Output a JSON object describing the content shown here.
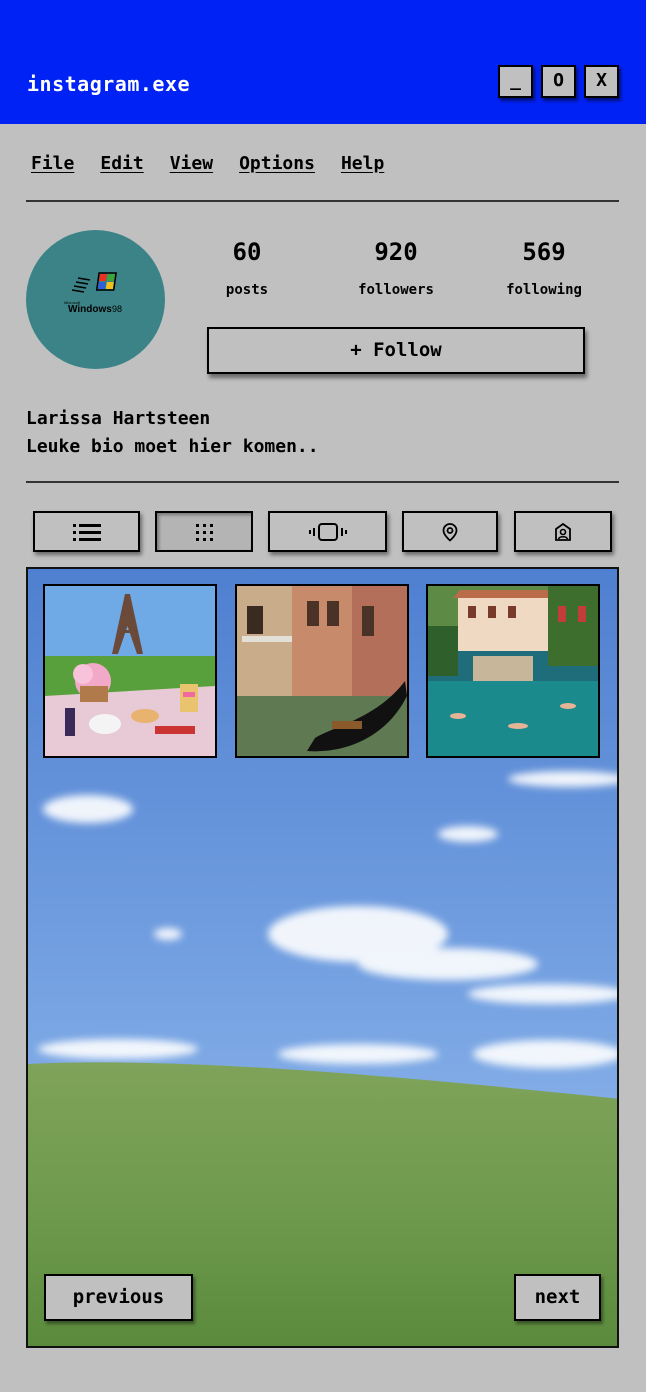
{
  "window": {
    "title": "instagram.exe",
    "minimize_label": "_",
    "maximize_label": "O",
    "close_label": "X",
    "title_bar_color": "#0022f5"
  },
  "menu": [
    {
      "label": "File"
    },
    {
      "label": "Edit"
    },
    {
      "label": "View"
    },
    {
      "label": "Options"
    },
    {
      "label": "Help"
    }
  ],
  "profile": {
    "avatar_logo": {
      "brand": "Microsoft",
      "product": "Windows",
      "version": "98"
    },
    "avatar_color": "#3b8387",
    "stats": [
      {
        "value": "60",
        "label": "posts"
      },
      {
        "value": "920",
        "label": "followers"
      },
      {
        "value": "569",
        "label": "following"
      }
    ],
    "follow_label": "+ Follow",
    "name": "Larissa Hartsteen",
    "bio": "Leuke bio moet hier komen.."
  },
  "tabs": [
    {
      "icon": "list-icon"
    },
    {
      "icon": "grid-icon",
      "active": true
    },
    {
      "icon": "reels-icon"
    },
    {
      "icon": "location-icon"
    },
    {
      "icon": "tagged-icon"
    }
  ],
  "posts": [
    {
      "subject": "picnic-eiffel-tower"
    },
    {
      "subject": "venice-gondola"
    },
    {
      "subject": "lake-villa-swimmers"
    }
  ],
  "pagination": {
    "previous_label": "previous",
    "next_label": "next"
  }
}
